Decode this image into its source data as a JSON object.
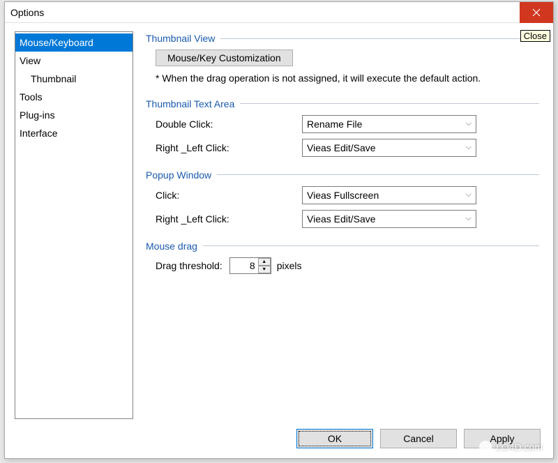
{
  "title": "Options",
  "close_tooltip": "Close",
  "sidebar": {
    "items": [
      {
        "label": "Mouse/Keyboard",
        "indent": false,
        "selected": true
      },
      {
        "label": "View",
        "indent": false,
        "selected": false
      },
      {
        "label": "Thumbnail",
        "indent": true,
        "selected": false
      },
      {
        "label": "Tools",
        "indent": false,
        "selected": false
      },
      {
        "label": "Plug-ins",
        "indent": false,
        "selected": false
      },
      {
        "label": "Interface",
        "indent": false,
        "selected": false
      }
    ]
  },
  "sections": {
    "thumbnail_view": {
      "title": "Thumbnail View",
      "customize_button": "Mouse/Key Customization",
      "note": "* When the drag operation is not assigned, it will execute the default action."
    },
    "thumbnail_text_area": {
      "title": "Thumbnail Text Area",
      "double_click_label": "Double Click:",
      "double_click_value": "Rename File",
      "right_left_label": "Right _Left Click:",
      "right_left_value": "Vieas Edit/Save"
    },
    "popup_window": {
      "title": "Popup Window",
      "click_label": "Click:",
      "click_value": "Vieas Fullscreen",
      "right_left_label": "Right _Left Click:",
      "right_left_value": "Vieas Edit/Save"
    },
    "mouse_drag": {
      "title": "Mouse drag",
      "threshold_label": "Drag threshold:",
      "threshold_value": "8",
      "threshold_suffix": "pixels"
    }
  },
  "buttons": {
    "ok": "OK",
    "cancel": "Cancel",
    "apply": "Apply"
  },
  "watermark": "LO4D.com"
}
